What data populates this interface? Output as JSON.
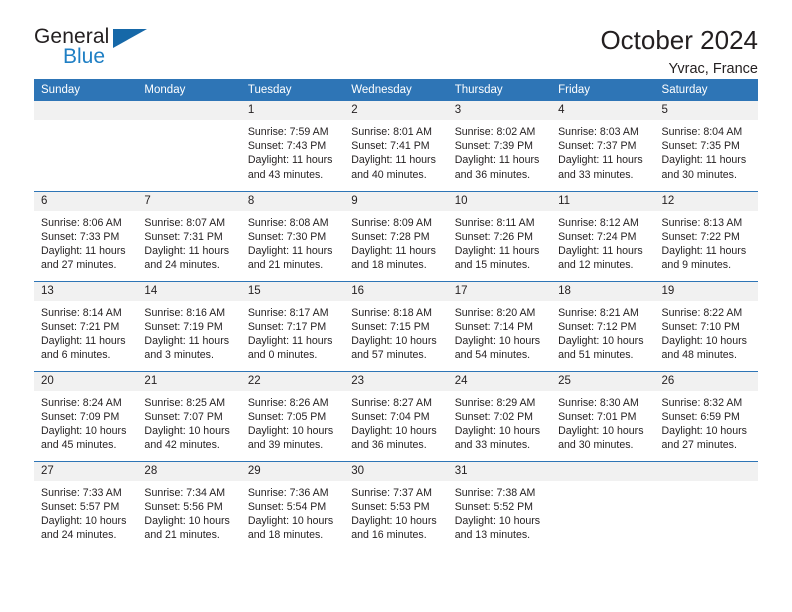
{
  "brand": {
    "name_part1": "General",
    "name_part2": "Blue",
    "triangle_color": "#1668a8",
    "blue_text_color": "#1f7fc4"
  },
  "header": {
    "title": "October 2024",
    "location": "Yvrac, France"
  },
  "theme": {
    "header_blue": "#2e75b6",
    "daynum_band": "#f1f1f1",
    "text": "#231f20"
  },
  "weekday_headers": [
    "Sunday",
    "Monday",
    "Tuesday",
    "Wednesday",
    "Thursday",
    "Friday",
    "Saturday"
  ],
  "weeks": [
    [
      {
        "day": "",
        "empty": true,
        "sunrise": "",
        "sunset": "",
        "daylight1": "",
        "daylight2": ""
      },
      {
        "day": "",
        "empty": true,
        "sunrise": "",
        "sunset": "",
        "daylight1": "",
        "daylight2": ""
      },
      {
        "day": "1",
        "sunrise": "Sunrise: 7:59 AM",
        "sunset": "Sunset: 7:43 PM",
        "daylight1": "Daylight: 11 hours",
        "daylight2": "and 43 minutes."
      },
      {
        "day": "2",
        "sunrise": "Sunrise: 8:01 AM",
        "sunset": "Sunset: 7:41 PM",
        "daylight1": "Daylight: 11 hours",
        "daylight2": "and 40 minutes."
      },
      {
        "day": "3",
        "sunrise": "Sunrise: 8:02 AM",
        "sunset": "Sunset: 7:39 PM",
        "daylight1": "Daylight: 11 hours",
        "daylight2": "and 36 minutes."
      },
      {
        "day": "4",
        "sunrise": "Sunrise: 8:03 AM",
        "sunset": "Sunset: 7:37 PM",
        "daylight1": "Daylight: 11 hours",
        "daylight2": "and 33 minutes."
      },
      {
        "day": "5",
        "sunrise": "Sunrise: 8:04 AM",
        "sunset": "Sunset: 7:35 PM",
        "daylight1": "Daylight: 11 hours",
        "daylight2": "and 30 minutes."
      }
    ],
    [
      {
        "day": "6",
        "sunrise": "Sunrise: 8:06 AM",
        "sunset": "Sunset: 7:33 PM",
        "daylight1": "Daylight: 11 hours",
        "daylight2": "and 27 minutes."
      },
      {
        "day": "7",
        "sunrise": "Sunrise: 8:07 AM",
        "sunset": "Sunset: 7:31 PM",
        "daylight1": "Daylight: 11 hours",
        "daylight2": "and 24 minutes."
      },
      {
        "day": "8",
        "sunrise": "Sunrise: 8:08 AM",
        "sunset": "Sunset: 7:30 PM",
        "daylight1": "Daylight: 11 hours",
        "daylight2": "and 21 minutes."
      },
      {
        "day": "9",
        "sunrise": "Sunrise: 8:09 AM",
        "sunset": "Sunset: 7:28 PM",
        "daylight1": "Daylight: 11 hours",
        "daylight2": "and 18 minutes."
      },
      {
        "day": "10",
        "sunrise": "Sunrise: 8:11 AM",
        "sunset": "Sunset: 7:26 PM",
        "daylight1": "Daylight: 11 hours",
        "daylight2": "and 15 minutes."
      },
      {
        "day": "11",
        "sunrise": "Sunrise: 8:12 AM",
        "sunset": "Sunset: 7:24 PM",
        "daylight1": "Daylight: 11 hours",
        "daylight2": "and 12 minutes."
      },
      {
        "day": "12",
        "sunrise": "Sunrise: 8:13 AM",
        "sunset": "Sunset: 7:22 PM",
        "daylight1": "Daylight: 11 hours",
        "daylight2": "and 9 minutes."
      }
    ],
    [
      {
        "day": "13",
        "sunrise": "Sunrise: 8:14 AM",
        "sunset": "Sunset: 7:21 PM",
        "daylight1": "Daylight: 11 hours",
        "daylight2": "and 6 minutes."
      },
      {
        "day": "14",
        "sunrise": "Sunrise: 8:16 AM",
        "sunset": "Sunset: 7:19 PM",
        "daylight1": "Daylight: 11 hours",
        "daylight2": "and 3 minutes."
      },
      {
        "day": "15",
        "sunrise": "Sunrise: 8:17 AM",
        "sunset": "Sunset: 7:17 PM",
        "daylight1": "Daylight: 11 hours",
        "daylight2": "and 0 minutes."
      },
      {
        "day": "16",
        "sunrise": "Sunrise: 8:18 AM",
        "sunset": "Sunset: 7:15 PM",
        "daylight1": "Daylight: 10 hours",
        "daylight2": "and 57 minutes."
      },
      {
        "day": "17",
        "sunrise": "Sunrise: 8:20 AM",
        "sunset": "Sunset: 7:14 PM",
        "daylight1": "Daylight: 10 hours",
        "daylight2": "and 54 minutes."
      },
      {
        "day": "18",
        "sunrise": "Sunrise: 8:21 AM",
        "sunset": "Sunset: 7:12 PM",
        "daylight1": "Daylight: 10 hours",
        "daylight2": "and 51 minutes."
      },
      {
        "day": "19",
        "sunrise": "Sunrise: 8:22 AM",
        "sunset": "Sunset: 7:10 PM",
        "daylight1": "Daylight: 10 hours",
        "daylight2": "and 48 minutes."
      }
    ],
    [
      {
        "day": "20",
        "sunrise": "Sunrise: 8:24 AM",
        "sunset": "Sunset: 7:09 PM",
        "daylight1": "Daylight: 10 hours",
        "daylight2": "and 45 minutes."
      },
      {
        "day": "21",
        "sunrise": "Sunrise: 8:25 AM",
        "sunset": "Sunset: 7:07 PM",
        "daylight1": "Daylight: 10 hours",
        "daylight2": "and 42 minutes."
      },
      {
        "day": "22",
        "sunrise": "Sunrise: 8:26 AM",
        "sunset": "Sunset: 7:05 PM",
        "daylight1": "Daylight: 10 hours",
        "daylight2": "and 39 minutes."
      },
      {
        "day": "23",
        "sunrise": "Sunrise: 8:27 AM",
        "sunset": "Sunset: 7:04 PM",
        "daylight1": "Daylight: 10 hours",
        "daylight2": "and 36 minutes."
      },
      {
        "day": "24",
        "sunrise": "Sunrise: 8:29 AM",
        "sunset": "Sunset: 7:02 PM",
        "daylight1": "Daylight: 10 hours",
        "daylight2": "and 33 minutes."
      },
      {
        "day": "25",
        "sunrise": "Sunrise: 8:30 AM",
        "sunset": "Sunset: 7:01 PM",
        "daylight1": "Daylight: 10 hours",
        "daylight2": "and 30 minutes."
      },
      {
        "day": "26",
        "sunrise": "Sunrise: 8:32 AM",
        "sunset": "Sunset: 6:59 PM",
        "daylight1": "Daylight: 10 hours",
        "daylight2": "and 27 minutes."
      }
    ],
    [
      {
        "day": "27",
        "sunrise": "Sunrise: 7:33 AM",
        "sunset": "Sunset: 5:57 PM",
        "daylight1": "Daylight: 10 hours",
        "daylight2": "and 24 minutes."
      },
      {
        "day": "28",
        "sunrise": "Sunrise: 7:34 AM",
        "sunset": "Sunset: 5:56 PM",
        "daylight1": "Daylight: 10 hours",
        "daylight2": "and 21 minutes."
      },
      {
        "day": "29",
        "sunrise": "Sunrise: 7:36 AM",
        "sunset": "Sunset: 5:54 PM",
        "daylight1": "Daylight: 10 hours",
        "daylight2": "and 18 minutes."
      },
      {
        "day": "30",
        "sunrise": "Sunrise: 7:37 AM",
        "sunset": "Sunset: 5:53 PM",
        "daylight1": "Daylight: 10 hours",
        "daylight2": "and 16 minutes."
      },
      {
        "day": "31",
        "sunrise": "Sunrise: 7:38 AM",
        "sunset": "Sunset: 5:52 PM",
        "daylight1": "Daylight: 10 hours",
        "daylight2": "and 13 minutes."
      },
      {
        "day": "",
        "empty": true,
        "sunrise": "",
        "sunset": "",
        "daylight1": "",
        "daylight2": ""
      },
      {
        "day": "",
        "empty": true,
        "sunrise": "",
        "sunset": "",
        "daylight1": "",
        "daylight2": ""
      }
    ]
  ]
}
